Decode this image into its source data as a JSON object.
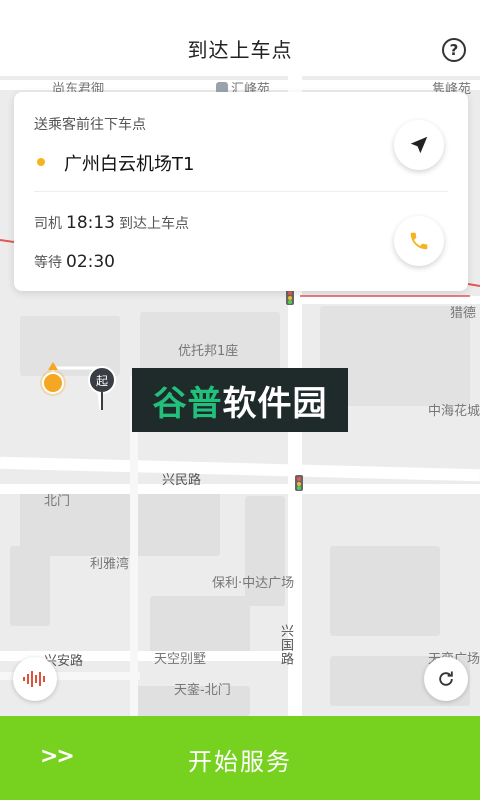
{
  "header": {
    "title": "到达上车点",
    "help_symbol": "?"
  },
  "card": {
    "subtitle": "送乘客前往下车点",
    "destination": "广州白云机场T1",
    "driver_label": "司机",
    "driver_time": "18:13",
    "driver_status": "到达上车点",
    "wait_label": "等待",
    "wait_time": "02:30",
    "nav_icon": "navigation-arrow-icon",
    "call_icon": "phone-icon"
  },
  "map": {
    "labels": {
      "top_left": "尚东君御",
      "huifeng": "汇峰苑",
      "jufeng": "隽峰苑",
      "liede": "猎德",
      "youtuobang": "优托邦1座",
      "zhonghai": "中海花城",
      "xingmin_road": "兴民路",
      "beimen": "北门",
      "liyawan": "利雅湾",
      "poly": "保利·中达广场",
      "xingguo_road": "兴国路",
      "tiankongbieshu": "天空别墅",
      "xingan_road": "兴安路",
      "tianluan_beimen": "天銮-北门",
      "tianluan_plaza": "天銮广场",
      "tian_right": "天"
    },
    "start_marker": "起"
  },
  "watermark": {
    "green_text": "谷普",
    "white_text": "软件园"
  },
  "bottom": {
    "arrows": ">>",
    "action_label": "开始服务"
  },
  "colors": {
    "accent_green": "#77d11f",
    "accent_yellow": "#f5b41f",
    "map_bg": "#ececec"
  }
}
